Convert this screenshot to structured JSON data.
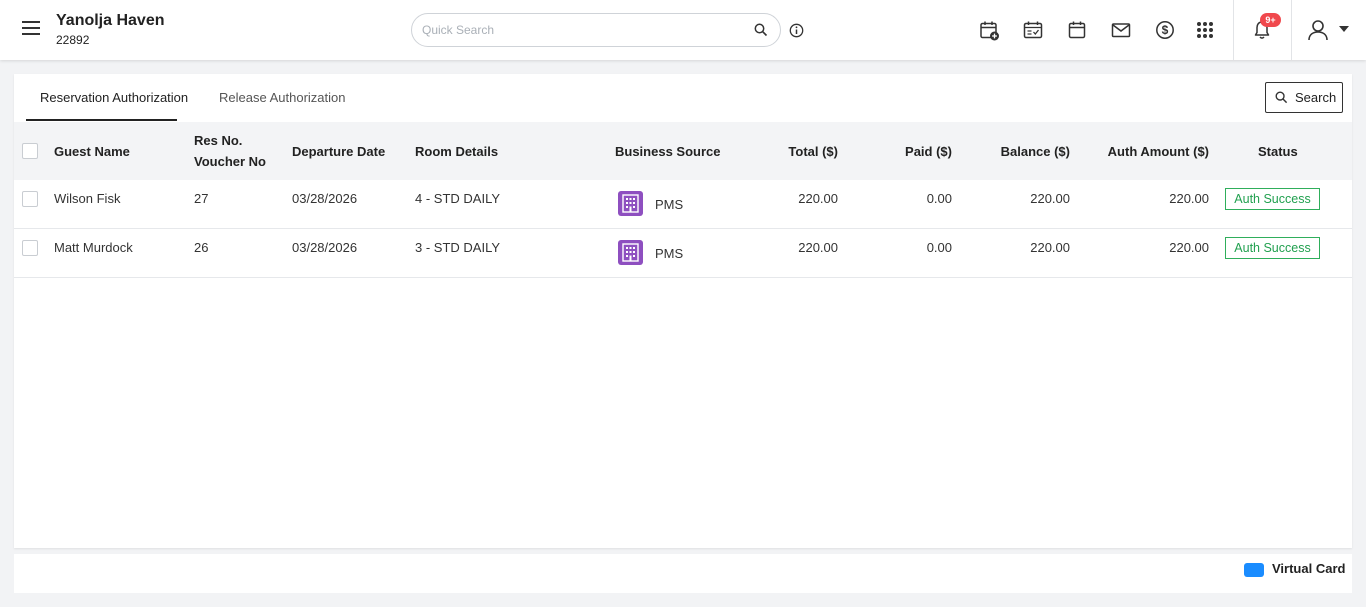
{
  "header": {
    "property_name": "Yanolja Haven",
    "property_id": "22892",
    "search_placeholder": "Quick Search",
    "notification_count": "9+"
  },
  "tabs": [
    {
      "label": "Reservation Authorization",
      "active": true
    },
    {
      "label": "Release Authorization",
      "active": false
    }
  ],
  "search_button_label": "Search",
  "table": {
    "columns": {
      "guest_name": "Guest Name",
      "res_no": "Res No.",
      "voucher_no": "Voucher No",
      "departure_date": "Departure Date",
      "room_details": "Room Details",
      "business_source": "Business Source",
      "total": "Total ($)",
      "paid": "Paid ($)",
      "balance": "Balance ($)",
      "auth_amount": "Auth Amount ($)",
      "status": "Status"
    },
    "rows": [
      {
        "guest_name": "Wilson Fisk",
        "res_no": "27",
        "departure_date": "03/28/2026",
        "room_details": "4 - STD DAILY",
        "business_source": "PMS",
        "total": "220.00",
        "paid": "0.00",
        "balance": "220.00",
        "auth_amount": "220.00",
        "status": "Auth Success"
      },
      {
        "guest_name": "Matt Murdock",
        "res_no": "26",
        "departure_date": "03/28/2026",
        "room_details": "3 - STD DAILY",
        "business_source": "PMS",
        "total": "220.00",
        "paid": "0.00",
        "balance": "220.00",
        "auth_amount": "220.00",
        "status": "Auth Success"
      }
    ]
  },
  "legend": {
    "virtual_card_label": "Virtual Card",
    "virtual_card_color": "#1a8cff"
  },
  "colors": {
    "status_success": "#21a04f",
    "source_icon": "#8e4fc0",
    "highlight": "#e5202a",
    "notification": "#f0484d"
  }
}
